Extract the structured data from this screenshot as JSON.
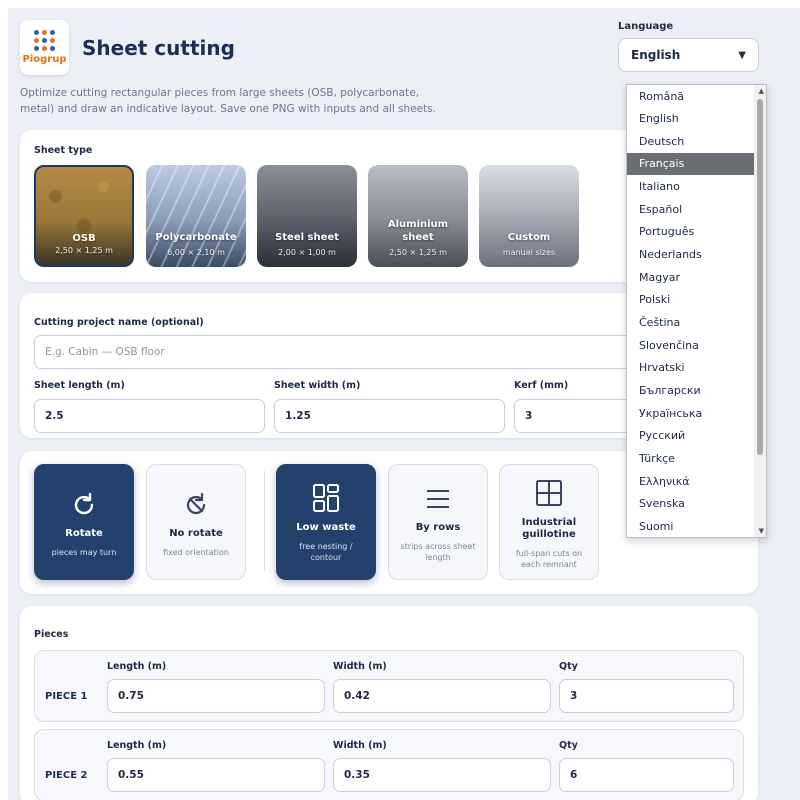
{
  "header": {
    "logo_text": "Piogrup",
    "title": "Sheet cutting",
    "subtitle": "Optimize cutting rectangular pieces from large sheets (OSB, polycarbonate, metal) and draw an indicative layout. Save one PNG with inputs and all sheets."
  },
  "language": {
    "label": "Language",
    "selected": "English",
    "options": [
      "Română",
      "English",
      "Deutsch",
      "Français",
      "Italiano",
      "Español",
      "Português",
      "Nederlands",
      "Magyar",
      "Polski",
      "Čeština",
      "Slovenčina",
      "Hrvatski",
      "Български",
      "Українська",
      "Русский",
      "Türkçe",
      "Ελληνικά",
      "Svenska",
      "Suomi"
    ],
    "highlighted": "Français"
  },
  "sheet_type": {
    "label": "Sheet type",
    "tiles": [
      {
        "name": "OSB",
        "dims": "2,50 × 1,25 m",
        "selected": true
      },
      {
        "name": "Polycarbonate",
        "dims": "6,00 × 2,10 m"
      },
      {
        "name": "Steel sheet",
        "dims": "2,00 × 1,00 m"
      },
      {
        "name": "Aluminium sheet",
        "dims": "2,50 × 1,25 m"
      },
      {
        "name": "Custom",
        "dims": "manual sizes"
      }
    ]
  },
  "project": {
    "name_label": "Cutting project name (optional)",
    "name_placeholder": "E.g. Cabin — OSB floor",
    "length_label": "Sheet length (m)",
    "length_value": "2.5",
    "width_label": "Sheet width (m)",
    "width_value": "1.25",
    "kerf_label": "Kerf (mm)",
    "kerf_value": "3"
  },
  "options": {
    "rotate": {
      "name": "Rotate",
      "desc": "pieces may turn",
      "active": true
    },
    "no_rotate": {
      "name": "No rotate",
      "desc": "fixed orientation"
    },
    "low_waste": {
      "name": "Low waste",
      "desc": "free nesting / contour",
      "active": true
    },
    "by_rows": {
      "name": "By rows",
      "desc": "strips across sheet length"
    },
    "guillotine": {
      "name": "Industrial guillotine",
      "desc": "full-span cuts on each remnant"
    }
  },
  "pieces": {
    "label": "Pieces",
    "length_label": "Length (m)",
    "width_label": "Width (m)",
    "qty_label": "Qty",
    "rows": [
      {
        "title": "PIECE 1",
        "length": "0.75",
        "width": "0.42",
        "qty": "3"
      },
      {
        "title": "PIECE 2",
        "length": "0.55",
        "width": "0.35",
        "qty": "6"
      }
    ]
  },
  "colors": {
    "primary": "#24416e",
    "page_bg": "#eceff5",
    "title": "#1b2f55",
    "logo_orange": "#e2721b",
    "highlight": "#6b6e73"
  }
}
